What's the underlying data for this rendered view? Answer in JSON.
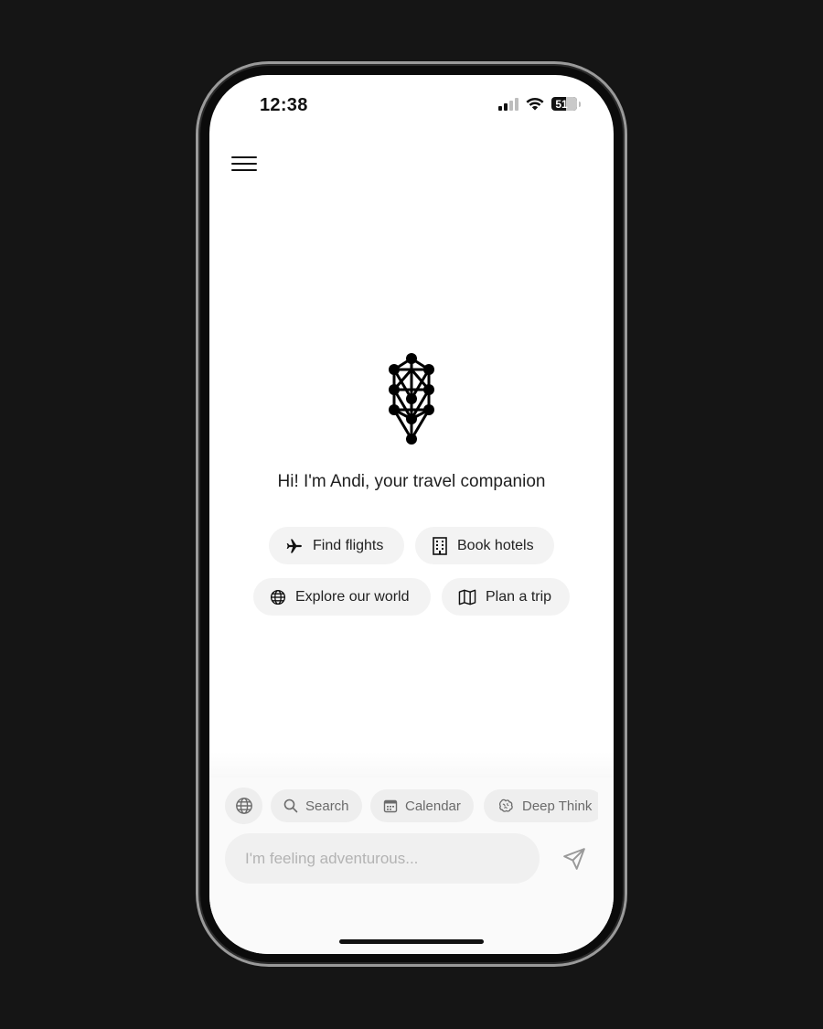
{
  "status_bar": {
    "time": "12:38",
    "battery_level": "51",
    "signal_bars_active": 2,
    "signal_bars_total": 4
  },
  "header": {
    "menu_icon": "hamburger-menu-icon"
  },
  "hero": {
    "logo_icon": "tree-of-life-logo",
    "greeting": "Hi! I'm Andi, your travel companion"
  },
  "suggestions": [
    {
      "label": "Find flights",
      "icon": "airplane-icon"
    },
    {
      "label": "Book hotels",
      "icon": "building-icon"
    },
    {
      "label": "Explore our world",
      "icon": "globe-icon"
    },
    {
      "label": "Plan a trip",
      "icon": "map-icon"
    }
  ],
  "tools": {
    "globe_icon": "globe-icon",
    "items": [
      {
        "label": "Search",
        "icon": "search-icon"
      },
      {
        "label": "Calendar",
        "icon": "calendar-icon"
      },
      {
        "label": "Deep Think",
        "icon": "brain-icon"
      }
    ]
  },
  "composer": {
    "placeholder": "I'm feeling adventurous...",
    "value": "",
    "send_icon": "send-icon"
  },
  "colors": {
    "background": "#151515",
    "screen": "#ffffff",
    "chip": "#f3f3f3",
    "text": "#1f1f1f",
    "muted": "#b3b3b3"
  }
}
